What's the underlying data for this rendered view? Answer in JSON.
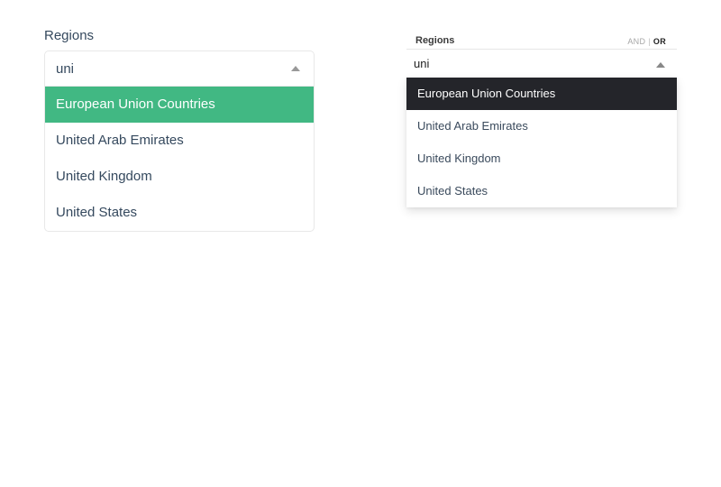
{
  "left_select": {
    "label": "Regions",
    "search_value": "uni",
    "options": [
      {
        "label": "European Union Countries",
        "highlighted": true
      },
      {
        "label": "United Arab Emirates",
        "highlighted": false
      },
      {
        "label": "United Kingdom",
        "highlighted": false
      },
      {
        "label": "United States",
        "highlighted": false
      }
    ],
    "highlight_color": "#41b883"
  },
  "right_select": {
    "label": "Regions",
    "logic_and": "AND",
    "logic_separator": "|",
    "logic_or": "OR",
    "logic_active": "OR",
    "search_value": "uni",
    "options": [
      {
        "label": "European Union Countries",
        "highlighted": true
      },
      {
        "label": "United Arab Emirates",
        "highlighted": false
      },
      {
        "label": "United Kingdom",
        "highlighted": false
      },
      {
        "label": "United States",
        "highlighted": false
      }
    ],
    "highlight_color": "#24252a"
  }
}
